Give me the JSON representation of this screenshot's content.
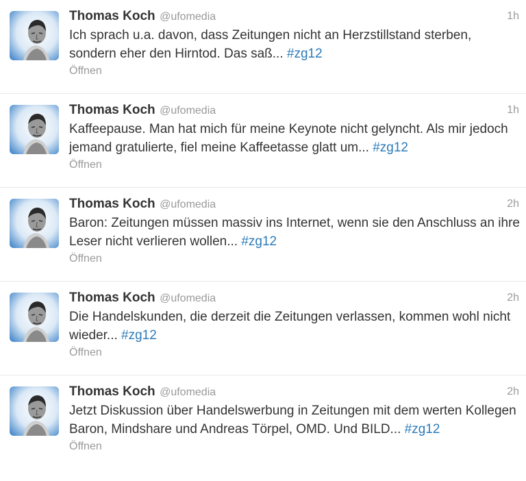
{
  "tweets": [
    {
      "name": "Thomas Koch",
      "handle": "@ufomedia",
      "time": "1h",
      "text": "Ich sprach u.a. davon, dass Zeitungen nicht an Herzstillstand sterben, sondern eher den Hirntod. Das saß...",
      "hashtag": "#zg12",
      "action": "Öffnen"
    },
    {
      "name": "Thomas Koch",
      "handle": "@ufomedia",
      "time": "1h",
      "text": "Kaffeepause. Man hat mich für meine Keynote nicht gelyncht. Als mir jedoch jemand gratulierte, fiel meine Kaffeetasse glatt um...",
      "hashtag": "#zg12",
      "action": "Öffnen"
    },
    {
      "name": "Thomas Koch",
      "handle": "@ufomedia",
      "time": "2h",
      "text": "Baron: Zeitungen müssen massiv ins Internet, wenn sie den Anschluss an ihre Leser nicht verlieren wollen...",
      "hashtag": "#zg12",
      "action": "Öffnen"
    },
    {
      "name": "Thomas Koch",
      "handle": "@ufomedia",
      "time": "2h",
      "text": "Die Handelskunden, die derzeit die Zeitungen verlassen, kommen wohl nicht wieder...",
      "hashtag": "#zg12",
      "action": "Öffnen"
    },
    {
      "name": "Thomas Koch",
      "handle": "@ufomedia",
      "time": "2h",
      "text": "Jetzt Diskussion über Handelswerbung in Zeitungen mit dem werten Kollegen Baron, Mindshare und Andreas Törpel, OMD. Und BILD...",
      "hashtag": "#zg12",
      "action": "Öffnen"
    }
  ]
}
